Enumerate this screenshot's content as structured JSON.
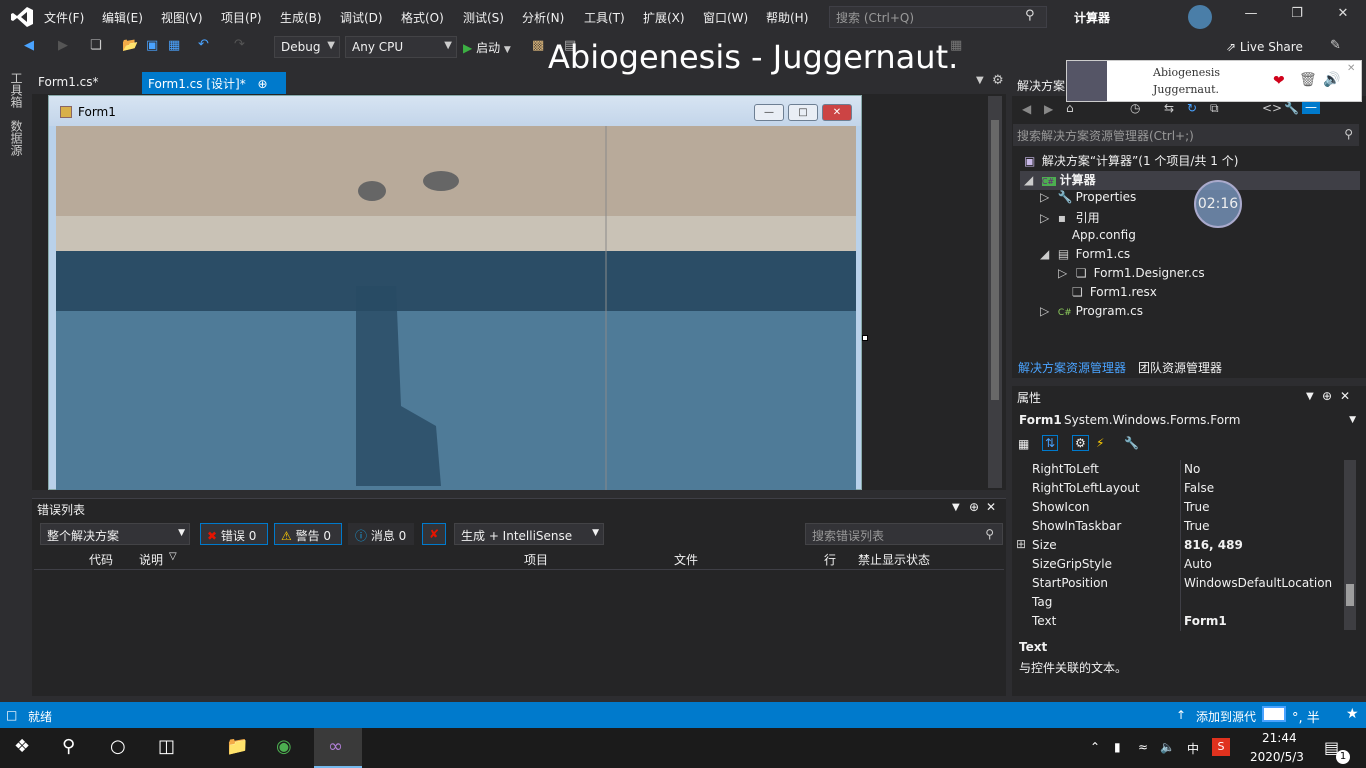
{
  "menu": {
    "items": [
      "文件(F)",
      "编辑(E)",
      "视图(V)",
      "项目(P)",
      "生成(B)",
      "调试(D)",
      "格式(O)",
      "测试(S)",
      "分析(N)",
      "工具(T)",
      "扩展(X)",
      "窗口(W)",
      "帮助(H)"
    ],
    "search_placeholder": "搜索 (Ctrl+Q)",
    "app_title": "计算器"
  },
  "toolbar": {
    "config": "Debug",
    "platform": "Any CPU",
    "start_label": "启动",
    "live_share": "Live Share"
  },
  "overlay": {
    "title": "Abiogenesis - Juggernaut."
  },
  "left_strip": {
    "toolbox": "工具箱",
    "datasource": "数据源"
  },
  "doc_tabs": {
    "tab1": "Form1.cs*",
    "tab2": "Form1.cs [设计]*"
  },
  "form": {
    "title": "Form1"
  },
  "error_list": {
    "title": "错误列表",
    "scope": "整个解决方案",
    "errors": "错误 0",
    "warnings": "警告 0",
    "messages": "消息 0",
    "source": "生成 + IntelliSense",
    "search_placeholder": "搜索错误列表",
    "columns": [
      "代码",
      "说明",
      "项目",
      "文件",
      "行",
      "禁止显示状态"
    ]
  },
  "solution": {
    "header": "解决方案",
    "search_placeholder": "搜索解决方案资源管理器(Ctrl+;)",
    "root": "解决方案“计算器”(1 个项目/共 1 个)",
    "project": "计算器",
    "items": [
      "Properties",
      "引用",
      "App.config",
      "Form1.cs",
      "Form1.Designer.cs",
      "Form1.resx",
      "Program.cs"
    ],
    "tab_solution": "解决方案资源管理器",
    "tab_team": "团队资源管理器"
  },
  "media": {
    "artist": "Abiogenesis",
    "track": "Juggernaut.",
    "timer": "02:16"
  },
  "properties": {
    "title": "属性",
    "object_name": "Form1",
    "object_type": "System.Windows.Forms.Form",
    "rows": [
      {
        "name": "RightToLeft",
        "value": "No"
      },
      {
        "name": "RightToLeftLayout",
        "value": "False"
      },
      {
        "name": "ShowIcon",
        "value": "True"
      },
      {
        "name": "ShowInTaskbar",
        "value": "True"
      },
      {
        "name": "Size",
        "value": "816, 489"
      },
      {
        "name": "SizeGripStyle",
        "value": "Auto"
      },
      {
        "name": "StartPosition",
        "value": "WindowsDefaultLocation"
      },
      {
        "name": "Tag",
        "value": ""
      },
      {
        "name": "Text",
        "value": "Form1"
      }
    ],
    "desc_title": "Text",
    "desc_text": "与控件关联的文本。"
  },
  "status": {
    "ready": "就绪",
    "add_source": "添加到源代",
    "ime_mode": "°, 半"
  },
  "taskbar": {
    "time": "21:44",
    "date": "2020/5/3",
    "ime": "中",
    "notification_count": "1"
  },
  "colors": {
    "accent": "#007acc",
    "bg": "#2d2d30",
    "panel": "#252526"
  }
}
